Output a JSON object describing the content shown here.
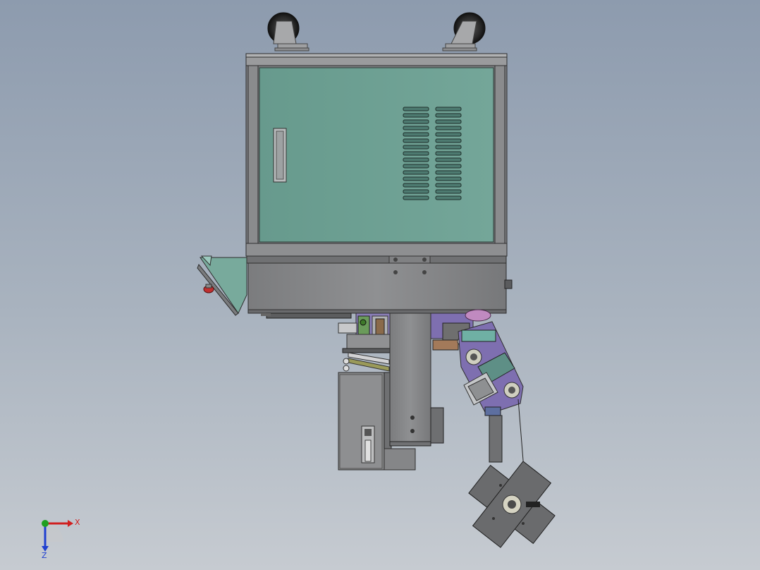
{
  "view": {
    "model": "cad-assembly-front-view",
    "colors": {
      "background_top": "#8d9bae",
      "background_bottom": "#c6cbd1",
      "cabinet_panel": "#6fa194",
      "frame": "#7a7c7f",
      "steel": "#8e8f91",
      "dark_steel": "#5f6062",
      "purple_part": "#7e6fb0",
      "pink_part": "#c08ac0",
      "brown_part": "#8a6a4a",
      "olive_part": "#9a9a5a",
      "teal_part": "#6fb0a4",
      "red_part": "#c03030"
    }
  },
  "triad": {
    "x_label": "X",
    "z_label": "Z",
    "x_color": "#d02020",
    "y_color": "#20a020",
    "z_color": "#2040d0"
  }
}
